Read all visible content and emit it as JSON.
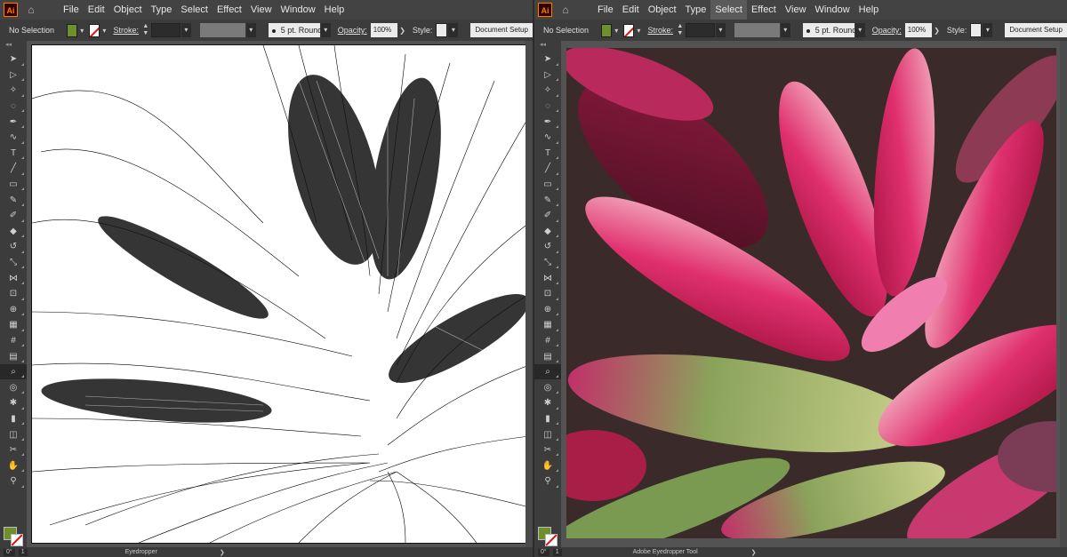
{
  "menus": [
    "File",
    "Edit",
    "Object",
    "Type",
    "Select",
    "Effect",
    "View",
    "Window",
    "Help"
  ],
  "logo": "Ai",
  "control": {
    "selection": "No Selection",
    "stroke_label": "Stroke:",
    "brush": "5 pt. Round",
    "opacity_label": "Opacity:",
    "opacity": "100%",
    "style_label": "Style:",
    "doc_setup": "Document Setup"
  },
  "colors": {
    "fill": "#6e8f2c",
    "stroke": "#ffffff",
    "accent": "#ff7c00"
  },
  "left": {
    "status_angle": "0°",
    "status_page": "1",
    "status_tool": "Eyedropper"
  },
  "right": {
    "status_angle": "0°",
    "status_page": "1",
    "status_tool": "Adobe Eyedropper Tool"
  },
  "tools": [
    "selection-tool-icon",
    "direct-selection-tool-icon",
    "magic-wand-icon",
    "lasso-icon",
    "pen-icon",
    "curvature-icon",
    "type-icon",
    "line-segment-icon",
    "rectangle-icon",
    "paintbrush-icon",
    "shaper-icon",
    "eraser-icon",
    "rotate-icon",
    "scale-icon",
    "width-icon",
    "free-transform-icon",
    "shape-builder-icon",
    "perspective-grid-icon",
    "mesh-icon",
    "gradient-icon",
    "eyedropper-icon",
    "blend-icon",
    "symbol-sprayer-icon",
    "column-graph-icon",
    "artboard-icon",
    "slice-icon",
    "hand-icon",
    "zoom-icon"
  ]
}
